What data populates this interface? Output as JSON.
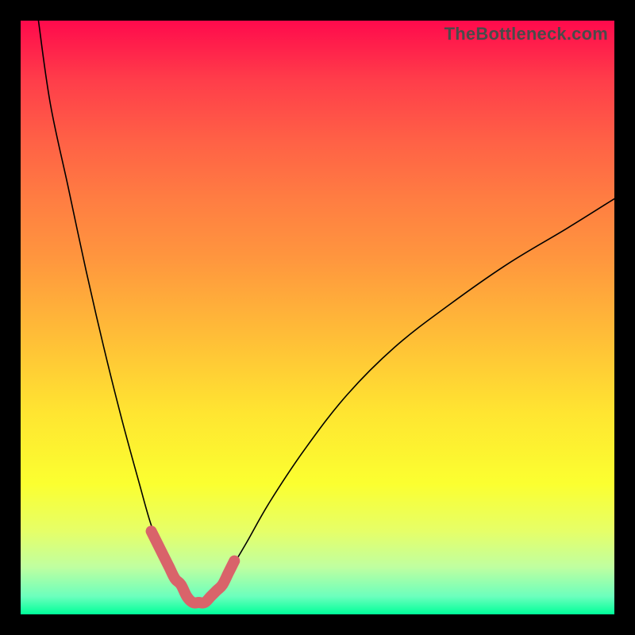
{
  "watermark": "TheBottleneck.com",
  "chart_data": {
    "type": "line",
    "title": "",
    "xlabel": "",
    "ylabel": "",
    "xlim": [
      0,
      100
    ],
    "ylim": [
      0,
      100
    ],
    "series": [
      {
        "name": "bottleneck-curve",
        "x": [
          3,
          5,
          8,
          11,
          14,
          17,
          20,
          22,
          24,
          26,
          27,
          28,
          29,
          30,
          31,
          32,
          33,
          35,
          38,
          42,
          48,
          55,
          63,
          72,
          82,
          92,
          100
        ],
        "values": [
          100,
          86,
          72,
          58,
          45,
          33,
          22,
          15,
          10,
          6,
          4,
          3,
          2,
          2,
          2,
          3,
          4,
          7,
          12,
          19,
          28,
          37,
          45,
          52,
          59,
          65,
          70
        ]
      }
    ],
    "highlight": {
      "name": "valley-highlight",
      "x": [
        22,
        24,
        25,
        26,
        27,
        28,
        29,
        30,
        31,
        32,
        33,
        34,
        35,
        36
      ],
      "values": [
        14,
        10,
        8,
        6,
        5,
        3,
        2,
        2,
        2,
        3,
        4,
        5,
        7,
        9
      ]
    }
  }
}
